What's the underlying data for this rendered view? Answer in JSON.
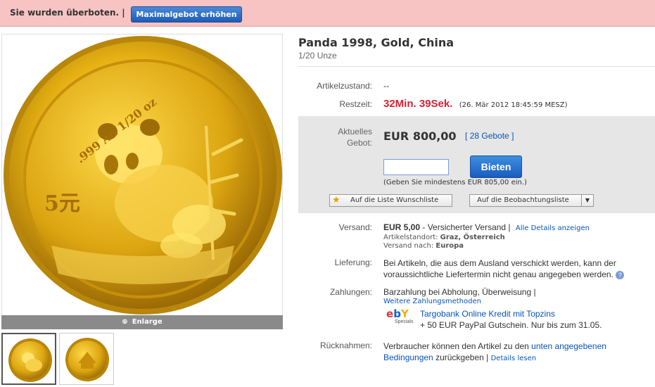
{
  "alert": {
    "message": "Sie wurden überboten.  |",
    "raise_bid_label": "Maximalgebot erhöhen"
  },
  "gallery": {
    "enlarge_label": "Enlarge",
    "coin_text": ".999 Au 1/20 oz",
    "coin_value": "5元"
  },
  "item": {
    "title": "Panda 1998, Gold, China",
    "subtitle": "1/20 Unze"
  },
  "condition": {
    "label": "Artikelzustand:",
    "value": "--"
  },
  "time": {
    "label": "Restzeit:",
    "remaining": "32Min. 39Sek.",
    "end": "(26. Mär 2012 18:45:59 MESZ)"
  },
  "bid": {
    "label_line1": "Aktuelles",
    "label_line2": "Gebot:",
    "price": "EUR 800,00",
    "bracket_open": "[",
    "bids_link": "28 Gebote",
    "bracket_close": "]",
    "input_value": "",
    "button_label": "Bieten",
    "hint": "(Geben Sie mindestens EUR 805,00 ein.)",
    "wishlist_label": "Auf die Liste Wunschliste",
    "watchlist_label": "Auf die Beobachtungsliste"
  },
  "shipping": {
    "label": "Versand:",
    "price": "EUR 5,00",
    "method": " - Versicherter Versand  |",
    "details_link": "Alle Details anzeigen",
    "location_label": "Artikelstandort:",
    "location": "Graz, Österreich",
    "ships_to_label": "Versand nach:",
    "ships_to": "Europa"
  },
  "delivery": {
    "label": "Lieferung:",
    "line1": "Bei Artikeln, die aus dem Ausland verschickt werden, kann der",
    "line2": "voraussichtliche Liefertermin nicht genau angegeben werden."
  },
  "payment": {
    "label": "Zahlungen:",
    "methods": "Barzahlung bei Abholung, Überweisung |",
    "more_link": "Weitere Zahlungsmethoden",
    "promo_link": "Targobank Online Kredit mit Topzins",
    "promo_text": "+ 50 EUR PayPal Gutschein. Nur bis zum 31.05.",
    "logo_text": "ebY",
    "logo_sub": "Specials"
  },
  "returns": {
    "label": "Rücknahmen:",
    "line1_text": "Verbraucher können den Artikel zu den",
    "line1_link": "unten angegebenen",
    "line2_link": "Bedingungen",
    "line2_text": "zurückgeben  |",
    "details_link": "Details lesen"
  },
  "colors": {
    "alert_bg": "#f7c3c3",
    "link": "#0654ba",
    "urgent": "#dd1e31",
    "button": "#1f5bb5",
    "gold": "#e2b21a"
  }
}
